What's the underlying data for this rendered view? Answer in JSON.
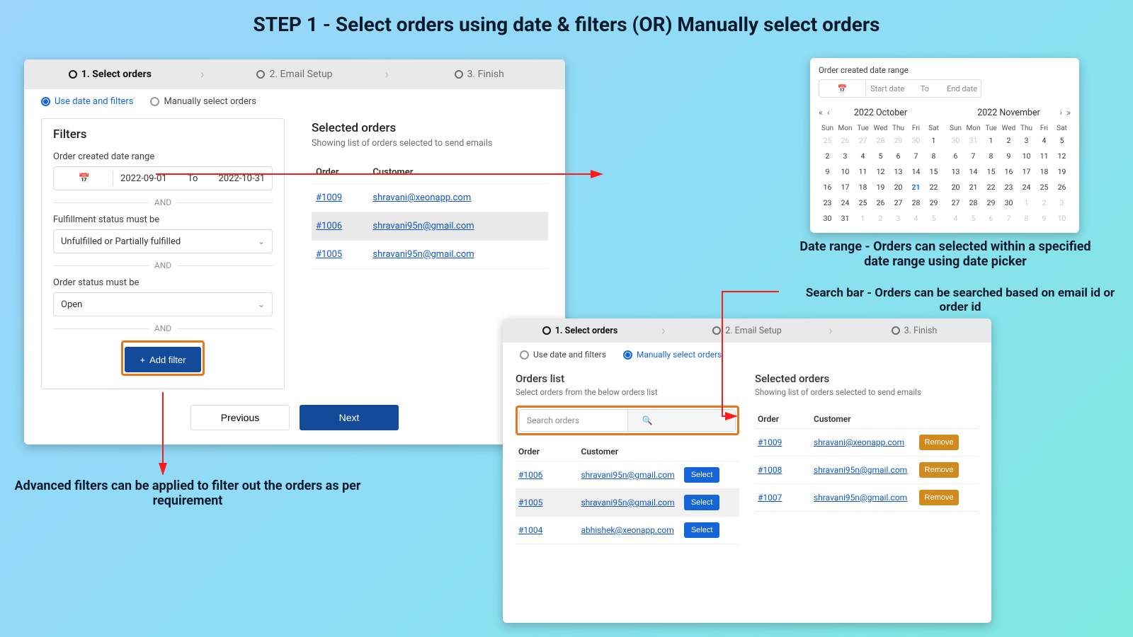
{
  "page_title": "STEP 1 - Select orders using date & filters (OR) Manually select orders",
  "wizard": {
    "step1": "1. Select orders",
    "step2": "2. Email Setup",
    "step3": "3. Finish"
  },
  "radio": {
    "use_date": "Use date and filters",
    "manual": "Manually select orders"
  },
  "filters": {
    "title": "Filters",
    "date_label": "Order created date range",
    "date_start": "2022-09-01",
    "date_to": "To",
    "date_end": "2022-10-31",
    "and": "AND",
    "fulfillment_label": "Fulfillment status must be",
    "fulfillment_value": "Unfulfilled or Partially fulfilled",
    "status_label": "Order status must be",
    "status_value": "Open",
    "add_filter": "Add filter"
  },
  "selected_a": {
    "title": "Selected orders",
    "sub": "Showing list of orders selected to send emails",
    "col_order": "Order",
    "col_customer": "Customer",
    "rows": [
      {
        "order": "#1009",
        "customer": "shravani@xeonapp.com"
      },
      {
        "order": "#1006",
        "customer": "shravani95n@gmail.com"
      },
      {
        "order": "#1005",
        "customer": "shravani95n@gmail.com"
      }
    ]
  },
  "buttons": {
    "previous": "Previous",
    "next": "Next"
  },
  "datepicker": {
    "label": "Order created date range",
    "start_ph": "Start date",
    "to": "To",
    "end_ph": "End date",
    "month1": "2022 October",
    "month2": "2022 November",
    "dow": [
      "Sun",
      "Mon",
      "Tue",
      "Wed",
      "Thu",
      "Fri",
      "Sat"
    ]
  },
  "caption_b": "Date range - Orders can selected within a specified date range using date picker",
  "caption_c_search": "Search bar - Orders can be searched based on email id or order id",
  "caption_c_filters": "Advanced filters can be applied to filter out the orders as per requirement",
  "orders_list": {
    "title": "Orders list",
    "sub": "Select orders from the below orders list",
    "search_ph": "Search orders",
    "col_order": "Order",
    "col_customer": "Customer",
    "rows": [
      {
        "order": "#1006",
        "customer": "shravani95n@gmail.com"
      },
      {
        "order": "#1005",
        "customer": "shravani95n@gmail.com"
      },
      {
        "order": "#1004",
        "customer": "abhishek@xeonapp.com"
      }
    ],
    "select": "Select"
  },
  "selected_c": {
    "title": "Selected orders",
    "sub": "Showing list of orders selected to send emails",
    "col_order": "Order",
    "col_customer": "Customer",
    "rows": [
      {
        "order": "#1009",
        "customer": "shravani@xeonapp.com"
      },
      {
        "order": "#1008",
        "customer": "shravani95n@gmail.com"
      },
      {
        "order": "#1007",
        "customer": "shravani95n@gmail.com"
      }
    ],
    "remove": "Remove"
  }
}
